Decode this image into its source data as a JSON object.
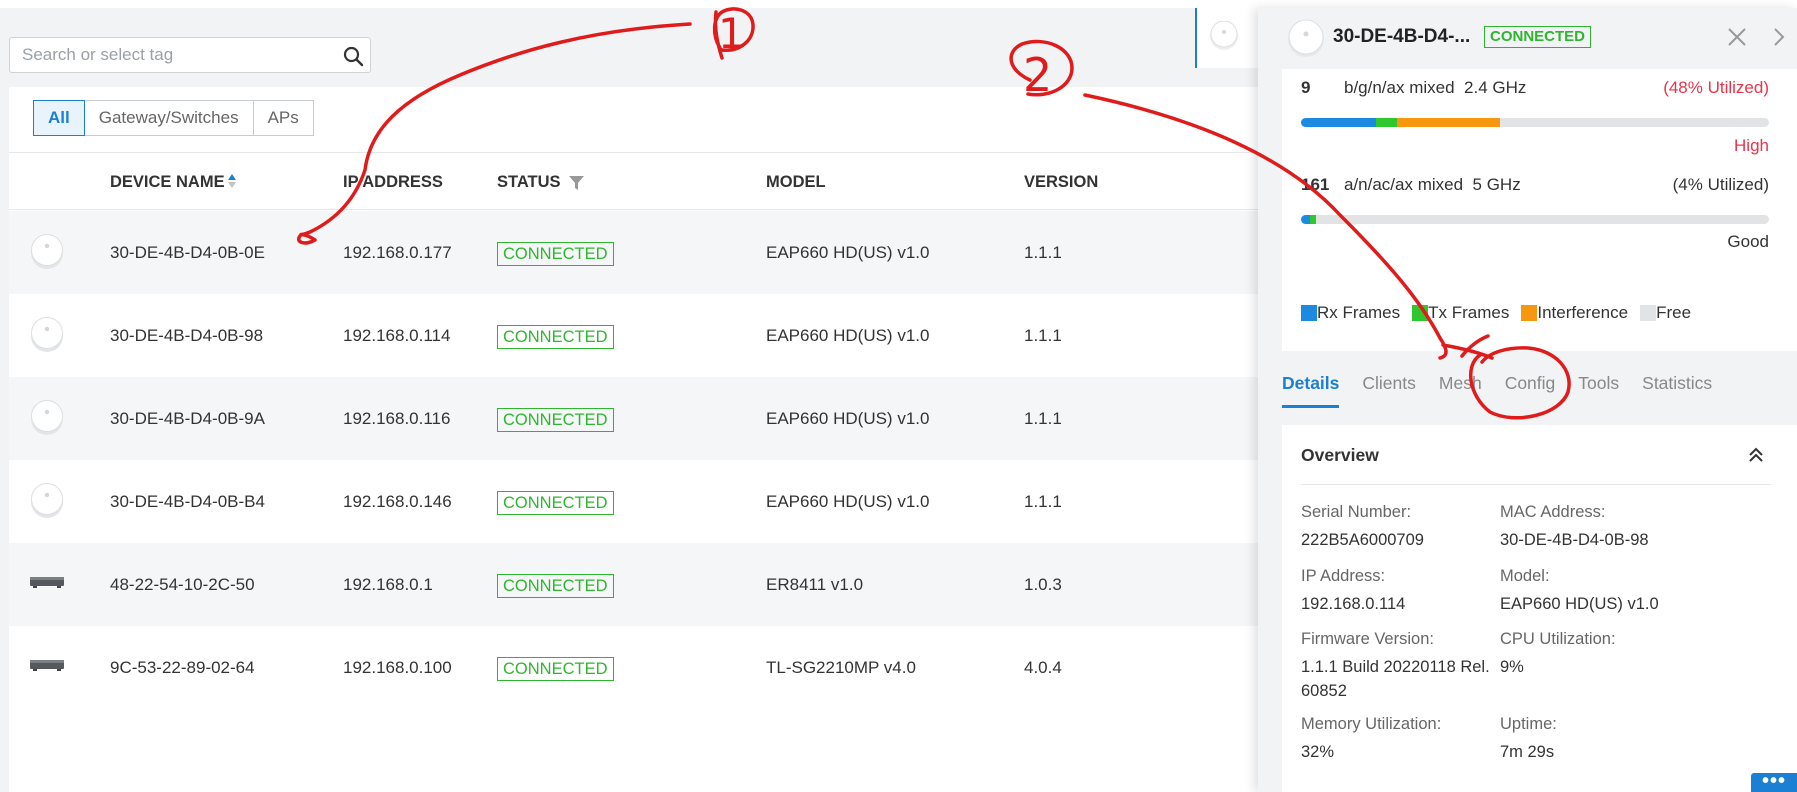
{
  "search": {
    "placeholder": "Search or select tag"
  },
  "filters": [
    "All",
    "Gateway/Switches",
    "APs"
  ],
  "table": {
    "headers": {
      "device_name": "DEVICE NAME",
      "ip_address": "IP ADDRESS",
      "status": "STATUS",
      "model": "MODEL",
      "version": "VERSION"
    },
    "rows": [
      {
        "icon": "ap-icon",
        "name": "30-DE-4B-D4-0B-0E",
        "ip": "192.168.0.177",
        "status": "CONNECTED",
        "model": "EAP660 HD(US) v1.0",
        "version": "1.1.1"
      },
      {
        "icon": "ap-icon",
        "name": "30-DE-4B-D4-0B-98",
        "ip": "192.168.0.114",
        "status": "CONNECTED",
        "model": "EAP660 HD(US) v1.0",
        "version": "1.1.1"
      },
      {
        "icon": "ap-icon",
        "name": "30-DE-4B-D4-0B-9A",
        "ip": "192.168.0.116",
        "status": "CONNECTED",
        "model": "EAP660 HD(US) v1.0",
        "version": "1.1.1"
      },
      {
        "icon": "ap-icon",
        "name": "30-DE-4B-D4-0B-B4",
        "ip": "192.168.0.146",
        "status": "CONNECTED",
        "model": "EAP660 HD(US) v1.0",
        "version": "1.1.1"
      },
      {
        "icon": "switch-icon",
        "name": "48-22-54-10-2C-50",
        "ip": "192.168.0.1",
        "status": "CONNECTED",
        "model": "ER8411 v1.0",
        "version": "1.0.3"
      },
      {
        "icon": "switch-icon",
        "name": "9C-53-22-89-02-64",
        "ip": "192.168.0.100",
        "status": "CONNECTED",
        "model": "TL-SG2210MP v4.0",
        "version": "4.0.4"
      }
    ]
  },
  "panel": {
    "title": "30-DE-4B-D4-...",
    "status": "CONNECTED",
    "radio_24": {
      "channel": "9",
      "mode": "b/g/n/ax mixed",
      "band": "2.4 GHz",
      "utilized": "(48% Utilized)",
      "level": "High",
      "rx_pct": 16,
      "tx_pct": 4.5,
      "interference_pct": 22
    },
    "radio_5": {
      "channel": "161",
      "mode": "a/n/ac/ax mixed",
      "band": "5 GHz",
      "utilized": "(4% Utilized)",
      "level": "Good",
      "rx_pct": 2,
      "tx_pct": 1.2,
      "interference_pct": 0
    },
    "legend": {
      "rx": "Rx Frames",
      "tx": "Tx Frames",
      "interference": "Interference",
      "free": "Free"
    },
    "tabs": [
      "Details",
      "Clients",
      "Mesh",
      "Config",
      "Tools",
      "Statistics"
    ],
    "overview": {
      "title": "Overview",
      "fields": [
        {
          "label": "Serial Number:",
          "value": "222B5A6000709"
        },
        {
          "label": "MAC Address:",
          "value": "30-DE-4B-D4-0B-98"
        },
        {
          "label": "IP Address:",
          "value": "192.168.0.114"
        },
        {
          "label": "Model:",
          "value": "EAP660 HD(US) v1.0"
        },
        {
          "label": "Firmware Version:",
          "value": "1.1.1 Build 20220118 Rel. 60852"
        },
        {
          "label": "CPU Utilization:",
          "value": "9%"
        },
        {
          "label": "Memory Utilization:",
          "value": "32%"
        },
        {
          "label": "Uptime:",
          "value": "7m 29s"
        }
      ]
    },
    "more_label": "•••"
  },
  "annotations": {
    "label_1": "1",
    "label_2": "2"
  },
  "colors": {
    "accent": "#1b7fd4",
    "connected": "#2fb52f",
    "rx": "#1b8ae0",
    "tx": "#2ec72e",
    "interference": "#f7960f",
    "free": "#e2e3e5",
    "high": "#e8334a",
    "annotation": "#e01b1b"
  }
}
